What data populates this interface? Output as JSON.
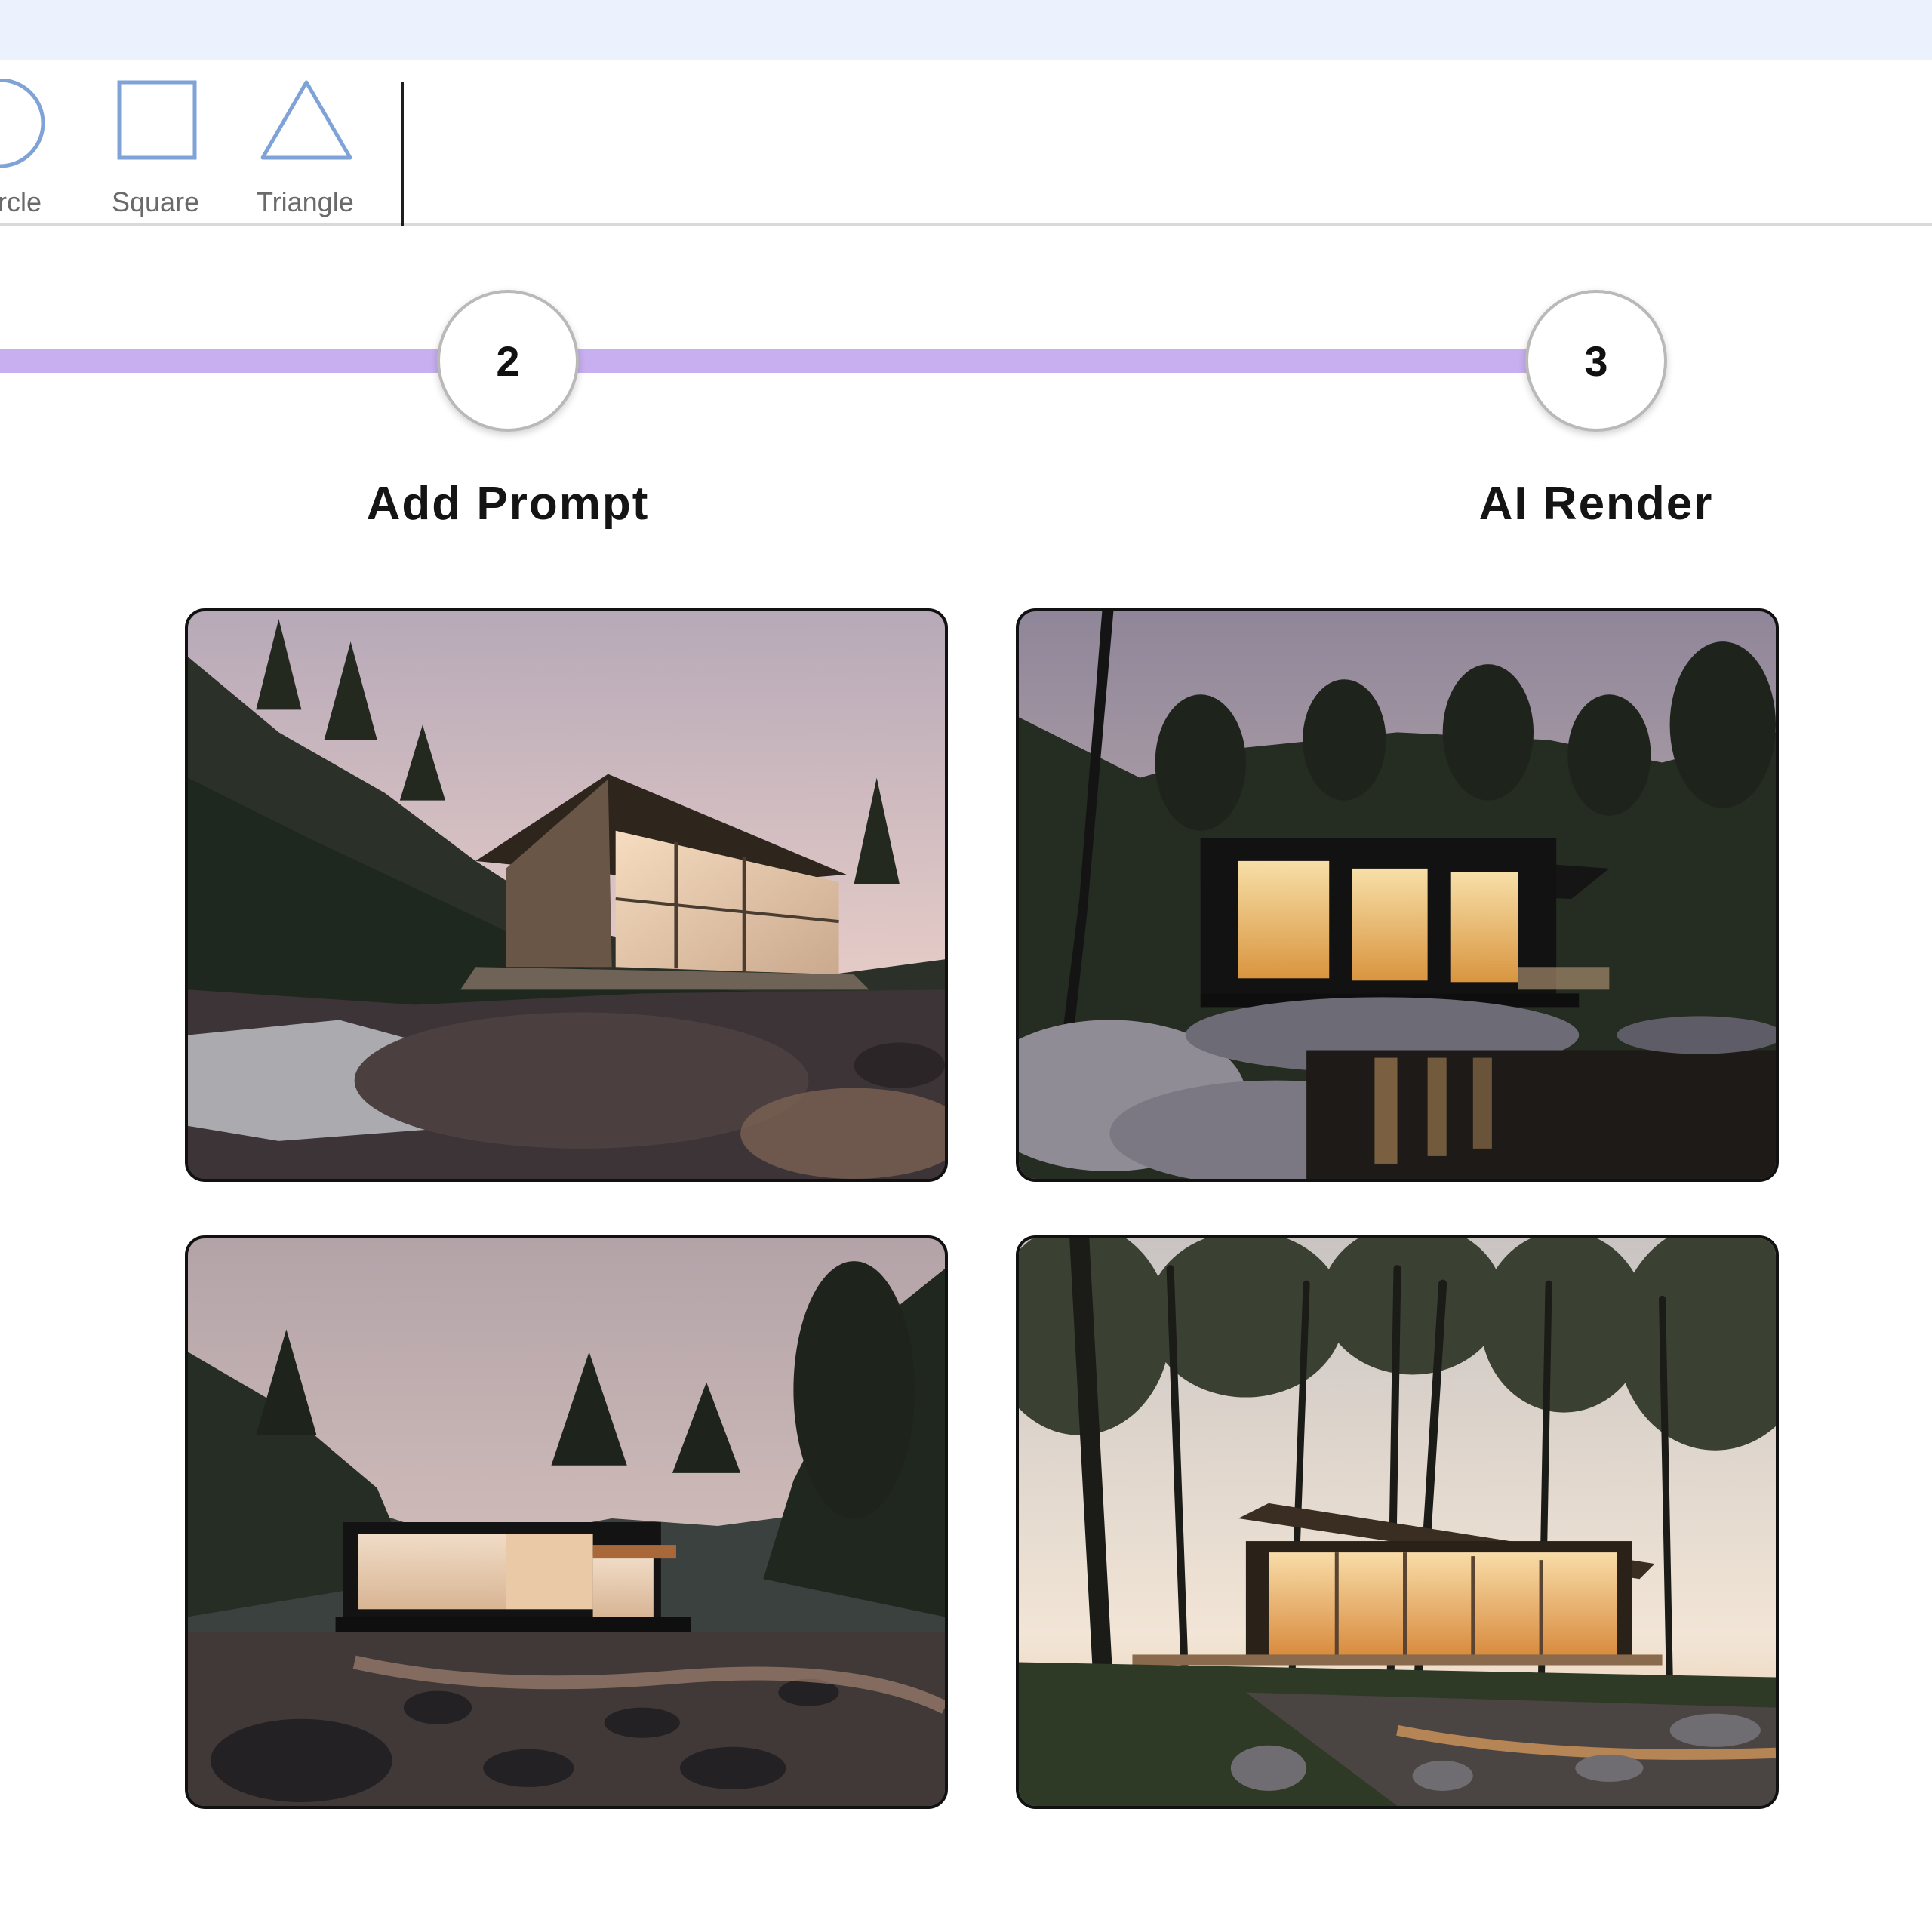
{
  "toolbar": {
    "tools": [
      {
        "label": "rcle",
        "icon": "circle-icon"
      },
      {
        "label": "Square",
        "icon": "square-icon"
      },
      {
        "label": "Triangle",
        "icon": "triangle-icon"
      }
    ]
  },
  "stepper": {
    "steps": [
      {
        "number": "2",
        "label": "Add Prompt"
      },
      {
        "number": "3",
        "label": "AI Render"
      }
    ],
    "track_color": "#c8aff0"
  },
  "renders": [
    {
      "subject": "cabin-by-stream-1"
    },
    {
      "subject": "cabin-by-stream-2"
    },
    {
      "subject": "cabin-by-stream-3"
    },
    {
      "subject": "cabin-in-forest-4"
    }
  ],
  "colors": {
    "top_strip": "#ebf1fd",
    "icon_stroke": "#7fa3d6",
    "tool_label": "#6a6a6a"
  }
}
